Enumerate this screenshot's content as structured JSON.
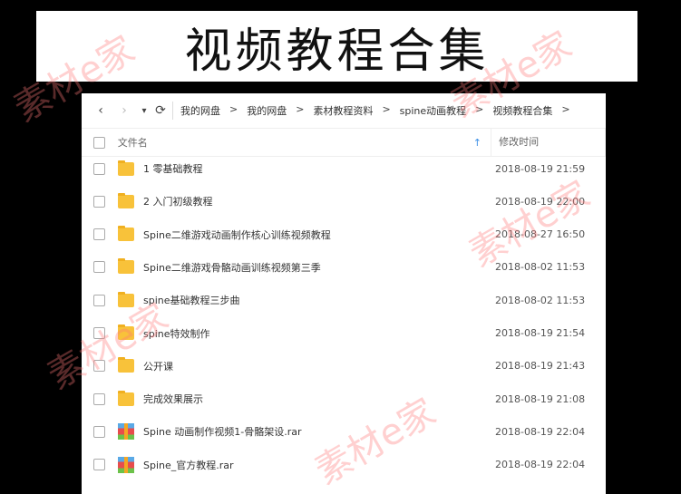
{
  "banner_title": "视频教程合集",
  "watermark": "素材e家",
  "nav": {
    "back": "‹",
    "forward": "›",
    "dropdown": "▾",
    "refresh": "⟳",
    "breadcrumbs": [
      "我的网盘",
      "我的网盘",
      "素材教程资料",
      "spine动画教程",
      "视频教程合集"
    ],
    "crumb_sep": ">"
  },
  "columns": {
    "name": "文件名",
    "date": "修改时间",
    "sort_icon": "↑"
  },
  "files": [
    {
      "name": "1 零基础教程",
      "date": "2018-08-19 21:59",
      "type": "folder"
    },
    {
      "name": "2 入门初级教程",
      "date": "2018-08-19 22:00",
      "type": "folder"
    },
    {
      "name": "Spine二维游戏动画制作核心训练视频教程",
      "date": "2018-08-27 16:50",
      "type": "folder"
    },
    {
      "name": "Spine二维游戏骨骼动画训练视频第三季",
      "date": "2018-08-02 11:53",
      "type": "folder"
    },
    {
      "name": "spine基础教程三步曲",
      "date": "2018-08-02 11:53",
      "type": "folder"
    },
    {
      "name": "spine特效制作",
      "date": "2018-08-19 21:54",
      "type": "folder"
    },
    {
      "name": "公开课",
      "date": "2018-08-19 21:43",
      "type": "folder"
    },
    {
      "name": "完成效果展示",
      "date": "2018-08-19 21:08",
      "type": "folder"
    },
    {
      "name": "Spine 动画制作视频1-骨骼架设.rar",
      "date": "2018-08-19 22:04",
      "type": "rar"
    },
    {
      "name": "Spine_官方教程.rar",
      "date": "2018-08-19 22:04",
      "type": "rar"
    }
  ]
}
